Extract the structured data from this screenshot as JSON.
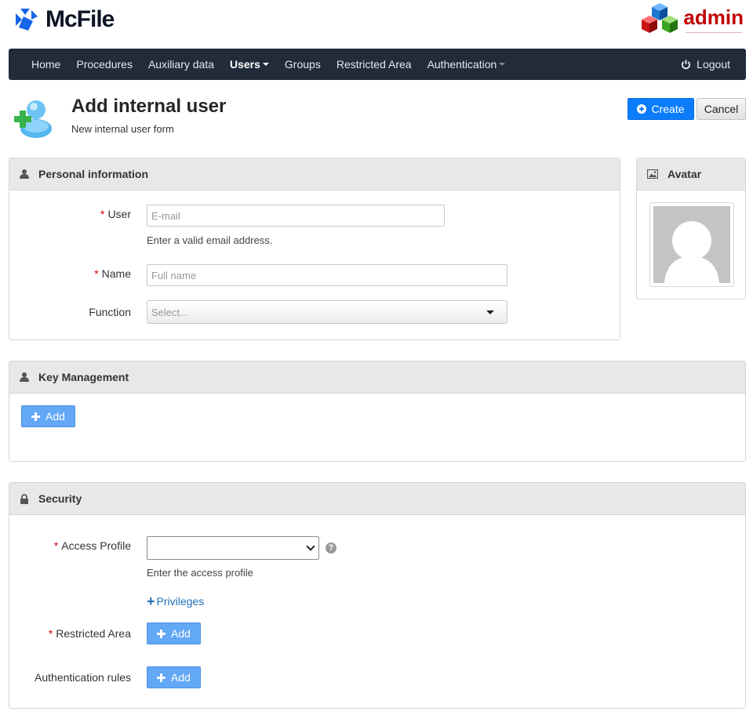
{
  "brand": {
    "name": "McFile",
    "admin_label": "admin"
  },
  "nav": {
    "items": [
      {
        "label": "Home"
      },
      {
        "label": "Procedures"
      },
      {
        "label": "Auxiliary data"
      },
      {
        "label": "Users"
      },
      {
        "label": "Groups"
      },
      {
        "label": "Restricted Area"
      },
      {
        "label": "Authentication"
      }
    ],
    "logout_label": "Logout"
  },
  "page": {
    "title": "Add internal user",
    "subtitle": "New internal user form",
    "create_label": "Create",
    "cancel_label": "Cancel"
  },
  "personal": {
    "heading": "Personal information",
    "user_label": "User",
    "user_placeholder": "E-mail",
    "user_help": "Enter a valid email address.",
    "name_label": "Name",
    "name_placeholder": "Full name",
    "function_label": "Function",
    "function_value": "Select..."
  },
  "avatar": {
    "heading": "Avatar"
  },
  "keys": {
    "heading": "Key Management",
    "add_label": "Add"
  },
  "security": {
    "heading": "Security",
    "access_profile_label": "Access Profile",
    "access_profile_value": "",
    "access_profile_help": "Enter the access profile",
    "privileges_label": "Privileges",
    "restricted_area_label": "Restricted Area",
    "restricted_add_label": "Add",
    "auth_rules_label": "Authentication rules",
    "auth_add_label": "Add",
    "help_glyph": "?"
  },
  "required_mark": "*",
  "colors": {
    "navbar": "#222b3a",
    "primary": "#0b7dfb",
    "add_button": "#62a8f5",
    "required": "#d40000"
  }
}
